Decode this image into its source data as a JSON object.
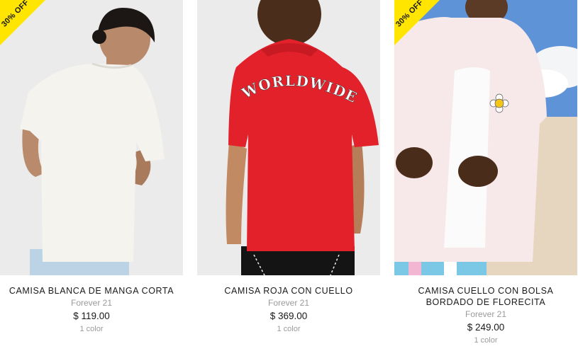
{
  "products": [
    {
      "name": "CAMISA BLANCA DE MANGA CORTA",
      "brand": "Forever 21",
      "price": "$ 119.00",
      "colors": "1 color",
      "badge": "30% OFF"
    },
    {
      "name": "CAMISA ROJA CON CUELLO",
      "brand": "Forever 21",
      "price": "$ 369.00",
      "colors": "1 color",
      "print_text": "WORLDWIDE"
    },
    {
      "name": "CAMISA CUELLO CON BOLSA BORDADO DE FLORECITA",
      "brand": "Forever 21",
      "price": "$ 249.00",
      "colors": "1 color",
      "badge": "30% OFF"
    }
  ],
  "colors": {
    "badge": "#ffe500",
    "shirt_red": "#e3212b",
    "shirt_white": "#f4f3ee",
    "text_muted": "#9b9b9b"
  }
}
